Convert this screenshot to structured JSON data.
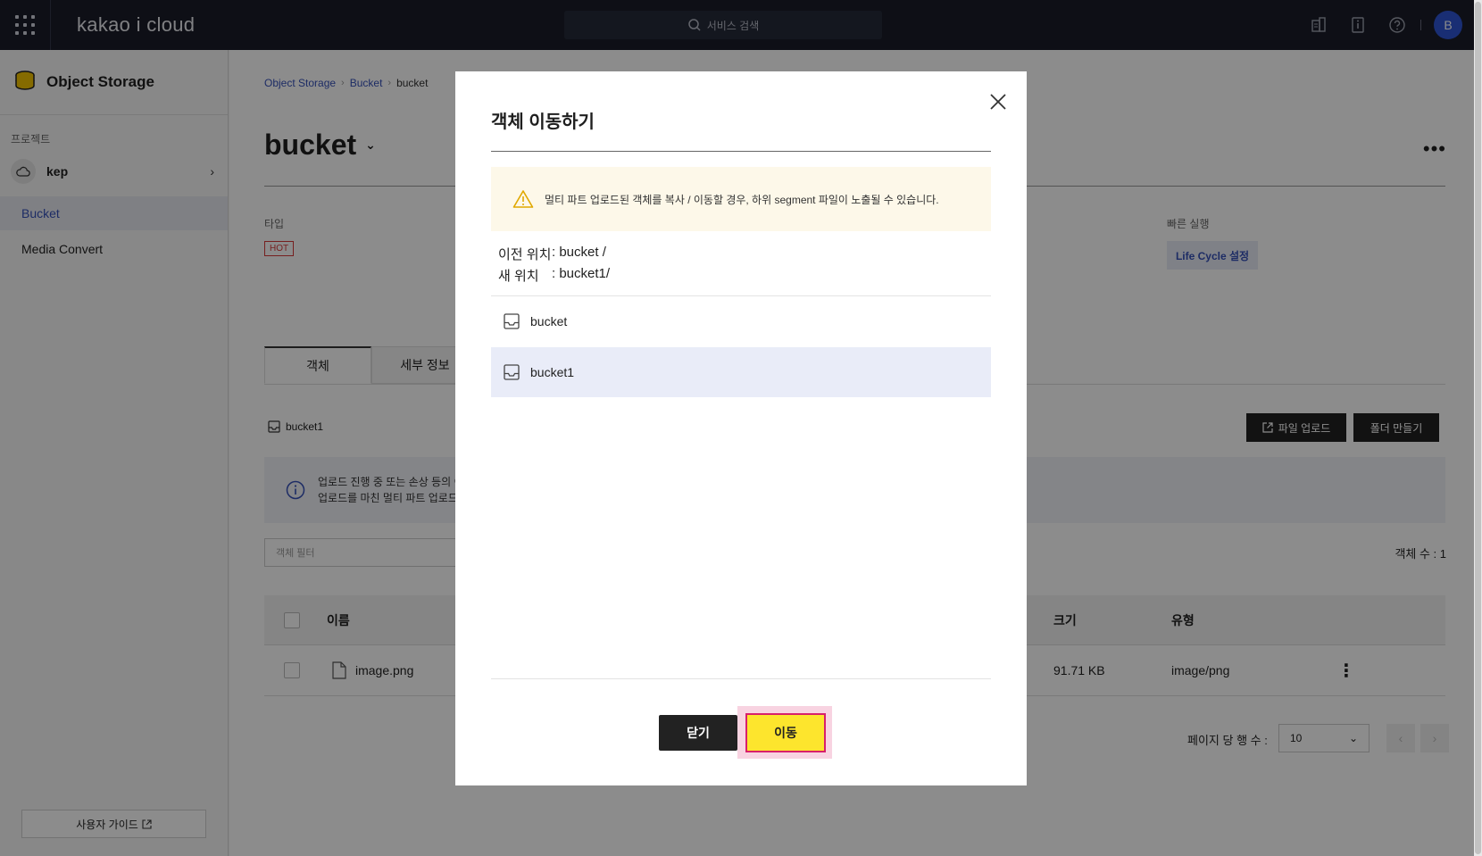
{
  "topbar": {
    "logo": "kakao i cloud",
    "search_placeholder": "서비스 검색",
    "avatar_initial": "B"
  },
  "sidebar": {
    "service_title": "Object Storage",
    "project_label": "프로젝트",
    "project_name": "kep",
    "items": [
      {
        "label": "Bucket",
        "active": true
      },
      {
        "label": "Media Convert",
        "active": false
      }
    ],
    "guide_label": "사용자 가이드"
  },
  "main": {
    "breadcrumb": [
      "Object Storage",
      "Bucket",
      "bucket"
    ],
    "title": "bucket",
    "type_label": "타입",
    "type_badge": "HOT",
    "quick_label": "빠른 실행",
    "lifecycle_label": "Life Cycle 설정",
    "tabs": [
      "객체",
      "세부 정보"
    ],
    "current_path": "bucket1",
    "upload_label": "파일 업로드",
    "folder_label": "폴더 만들기",
    "info_line1": "업로드 진행 중 또는 손상 등의 이",
    "info_line2": "업로드를 마친 멀티 파트 업로드",
    "filter_placeholder": "객체 필터",
    "object_count": "객체 수 : 1",
    "columns": {
      "name": "이름",
      "size": "크기",
      "type": "유형"
    },
    "rows": [
      {
        "name": "image.png",
        "size": "91.71 KB",
        "type": "image/png"
      }
    ],
    "rows_per_page_label": "페이지 당 행 수 :",
    "rows_per_page_value": "10"
  },
  "modal": {
    "title": "객체 이동하기",
    "warning": "멀티 파트 업로드된 객체를 복사 / 이동할 경우, 하위 segment 파일이 노출될 수 있습니다.",
    "prev_label": "이전 위치",
    "prev_value": ": bucket  /",
    "new_label": "새 위치",
    "new_value": ": bucket1/",
    "buckets": [
      {
        "name": "bucket",
        "selected": false
      },
      {
        "name": "bucket1",
        "selected": true
      }
    ],
    "close_label": "닫기",
    "move_label": "이동"
  }
}
